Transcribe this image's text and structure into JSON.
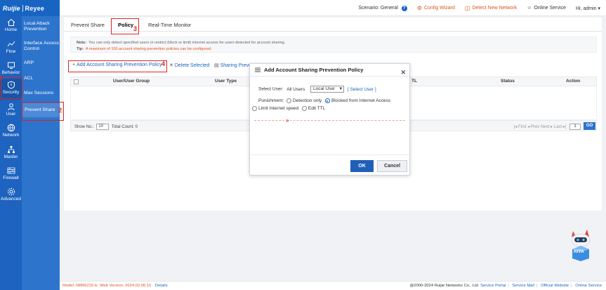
{
  "brand": {
    "left": "Ruijie",
    "right": "Reyee"
  },
  "header": {
    "scenario_label": "Scenario:",
    "scenario_value": "General",
    "config_wizard": "Config Wizard",
    "detect_network": "Detect New Network",
    "online_service": "Online Service",
    "greeting": "Hi, admin"
  },
  "sidenav": {
    "items": [
      {
        "label": "Home",
        "icon": "home-icon"
      },
      {
        "label": "Flow",
        "icon": "flow-icon"
      },
      {
        "label": "Behavior",
        "icon": "behavior-icon"
      },
      {
        "label": "Security",
        "icon": "shield-icon"
      },
      {
        "label": "User",
        "icon": "user-icon"
      },
      {
        "label": "Network",
        "icon": "globe-icon"
      },
      {
        "label": "Master",
        "icon": "topology-icon"
      },
      {
        "label": "Firewall",
        "icon": "firewall-icon"
      },
      {
        "label": "Advanced",
        "icon": "gear-icon"
      }
    ]
  },
  "subnav": {
    "items": [
      {
        "label": "Local Attack Prevention"
      },
      {
        "label": "Interface Access Control"
      },
      {
        "label": "ARP"
      },
      {
        "label": "ACL"
      },
      {
        "label": "Max Sessions"
      },
      {
        "label": "Prevent Share"
      }
    ]
  },
  "annotations": {
    "n1": "1",
    "n2": "2",
    "n3": "3",
    "n4": "4"
  },
  "tabs": [
    {
      "label": "Prevent Share"
    },
    {
      "label": "Policy"
    },
    {
      "label": "Real-Time Monitor"
    }
  ],
  "notes": {
    "note_label": "Note:",
    "note_text": "You can only detect specified users or restrict (block or limit) internet access for users detected for account sharing.",
    "tip_label": "Tip:",
    "tip_text": "A maximum of 100 account sharing prevention policies can be configured."
  },
  "toolbar": {
    "add": "Add Account Sharing Prevention Policy",
    "delete": "Delete Selected",
    "sharing": "Sharing Preve"
  },
  "table": {
    "headers": [
      "User/User Group",
      "User Type",
      "TL",
      "Status",
      "Action"
    ]
  },
  "pager": {
    "show_no": "Show No.:",
    "per_page": "10",
    "total": "Total Count: 0",
    "first": "First",
    "prev": "Prev",
    "next": "Next",
    "last": "Last",
    "page": "1",
    "go": "GO"
  },
  "modal": {
    "title": "Add Account Sharing Prevention Policy",
    "select_user_label": "Select User:",
    "select_user_value": "All Users",
    "user_type": "Local User",
    "select_user_link": "[ Select User ]",
    "punishment_label": "Punishment:",
    "opt_detect": "Detection only",
    "opt_blocked": "Blocked from Internet Access",
    "opt_limit": "Limit Internet speed",
    "opt_ttl": "Edit TTL",
    "expand": "»",
    "ok": "OK",
    "cancel": "Cancel"
  },
  "mascot": {
    "label": "RITA"
  },
  "footer": {
    "model": "Model: NBR6215-E",
    "web_version": "Web Version: 2024.02.06.10",
    "details": "Details",
    "copyright": "@2000-2024 Ruijie Networks Co., Ltd",
    "service_portal": "Service Portal",
    "service_mail": "Service Mail",
    "official_website": "Official Website",
    "online_service": "Online Service"
  },
  "colors": {
    "primary": "#1764c2",
    "sidebar": "#1d63bf",
    "subnav": "#2d74cc",
    "warn": "#e0531f",
    "highlight": "#e02424"
  }
}
